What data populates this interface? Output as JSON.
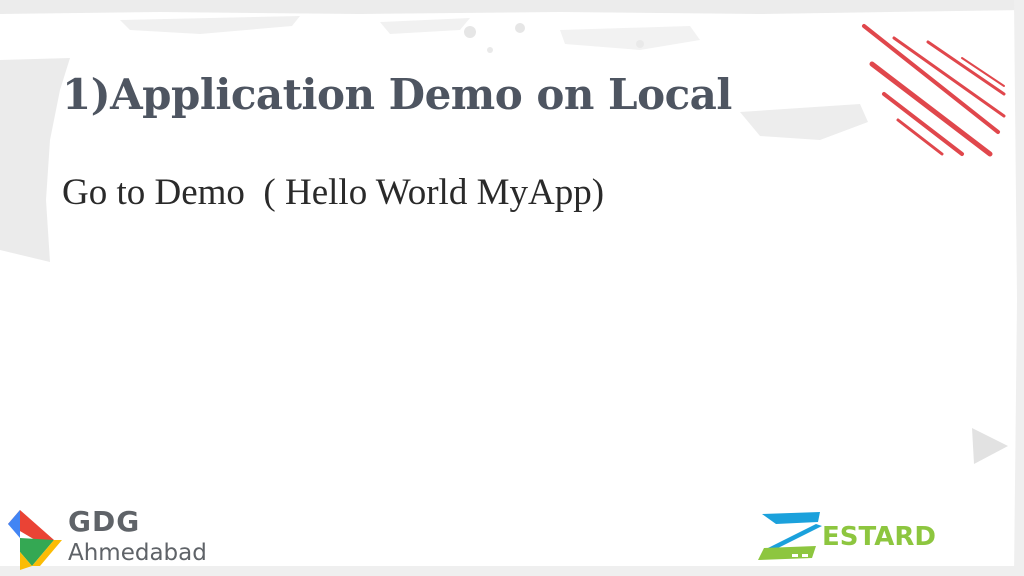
{
  "slide": {
    "title": "1)Application Demo on Local",
    "body": "Go to Demo  ( Hello World MyApp)"
  },
  "logos": {
    "gdg": {
      "name": "GDG",
      "city": "Ahmedabad",
      "mark_icon": "gdg-chevron-icon"
    },
    "zestard": {
      "name": "ESTARD",
      "mark_icon": "zestard-z-icon"
    }
  },
  "decorations": {
    "streaks_icon": "red-diagonal-streaks",
    "play_icon": "play-triangle-icon"
  },
  "colors": {
    "title": "#4e5561",
    "body": "#2a2a2a",
    "accent_red": "#e0474c",
    "gdg_blue": "#4285f4",
    "gdg_red": "#ea4335",
    "gdg_green": "#34a853",
    "gdg_yellow": "#fbbc05",
    "zestard_blue": "#1ba1dc",
    "zestard_green": "#8dc63f",
    "texture": "#ececec"
  }
}
